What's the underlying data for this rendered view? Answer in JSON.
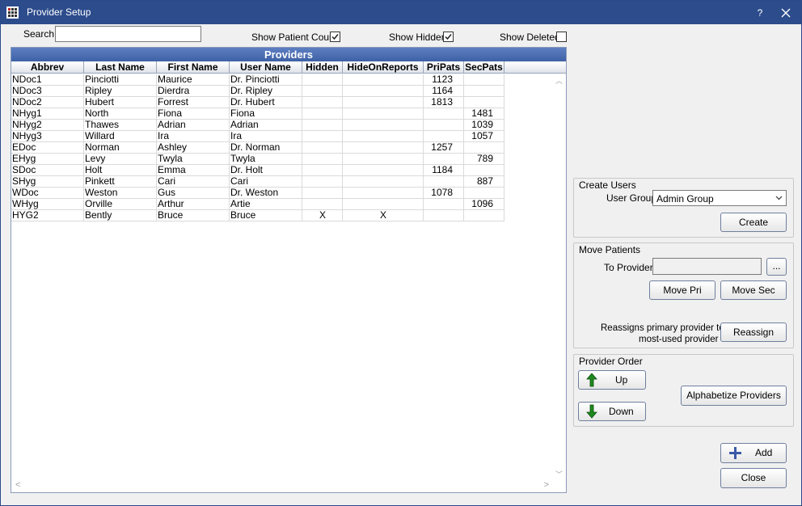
{
  "window": {
    "title": "Provider Setup",
    "help": "?"
  },
  "search": {
    "label": "Search",
    "value": ""
  },
  "filters": {
    "show_patient_count": {
      "label": "Show Patient Count",
      "checked": true
    },
    "show_hidden": {
      "label": "Show Hidden",
      "checked": true
    },
    "show_deleted": {
      "label": "Show Deleted",
      "checked": false
    }
  },
  "grid": {
    "title": "Providers",
    "columns": [
      "Abbrev",
      "Last Name",
      "First Name",
      "User Name",
      "Hidden",
      "HideOnReports",
      "PriPats",
      "SecPats"
    ],
    "rows": [
      [
        "NDoc1",
        "Pinciotti",
        "Maurice",
        "Dr. Pinciotti",
        "",
        "",
        "1123",
        ""
      ],
      [
        "NDoc3",
        "Ripley",
        "Dierdra",
        "Dr. Ripley",
        "",
        "",
        "1164",
        ""
      ],
      [
        "NDoc2",
        "Hubert",
        "Forrest",
        "Dr. Hubert",
        "",
        "",
        "1813",
        ""
      ],
      [
        "NHyg1",
        "North",
        "Fiona",
        "Fiona",
        "",
        "",
        "",
        "1481"
      ],
      [
        "NHyg2",
        "Thawes",
        "Adrian",
        "Adrian",
        "",
        "",
        "",
        "1039"
      ],
      [
        "NHyg3",
        "Willard",
        "Ira",
        "Ira",
        "",
        "",
        "",
        "1057"
      ],
      [
        "EDoc",
        "Norman",
        "Ashley",
        "Dr. Norman",
        "",
        "",
        "1257",
        ""
      ],
      [
        "EHyg",
        "Levy",
        "Twyla",
        "Twyla",
        "",
        "",
        "",
        "789"
      ],
      [
        "SDoc",
        "Holt",
        "Emma",
        "Dr. Holt",
        "",
        "",
        "1184",
        ""
      ],
      [
        "SHyg",
        "Pinkett",
        "Cari",
        "Cari",
        "",
        "",
        "",
        "887"
      ],
      [
        "WDoc",
        "Weston",
        "Gus",
        "Dr. Weston",
        "",
        "",
        "1078",
        ""
      ],
      [
        "WHyg",
        "Orville",
        "Arthur",
        "Artie",
        "",
        "",
        "",
        "1096"
      ],
      [
        "HYG2",
        "Bently",
        "Bruce",
        "Bruce",
        "X",
        "X",
        "",
        ""
      ]
    ]
  },
  "create_users": {
    "title": "Create Users",
    "user_group_label": "User Group",
    "user_group_value": "Admin Group",
    "create_button": "Create"
  },
  "move_patients": {
    "title": "Move Patients",
    "to_provider_label": "To Provider",
    "to_provider_value": "",
    "browse_button": "...",
    "move_pri_button": "Move Pri",
    "move_sec_button": "Move Sec",
    "reassign_note_line1": "Reassigns primary provider to",
    "reassign_note_line2": "most-used provider",
    "reassign_button": "Reassign"
  },
  "provider_order": {
    "title": "Provider Order",
    "up_button": "Up",
    "down_button": "Down",
    "alphabetize_button": "Alphabetize Providers"
  },
  "footer": {
    "add_button": "Add",
    "close_button": "Close"
  },
  "colors": {
    "titlebar": "#2c4c8c",
    "grid_header": "#3e61a6",
    "arrow_green": "#1e8a1e",
    "add_blue": "#3a5aa8"
  }
}
